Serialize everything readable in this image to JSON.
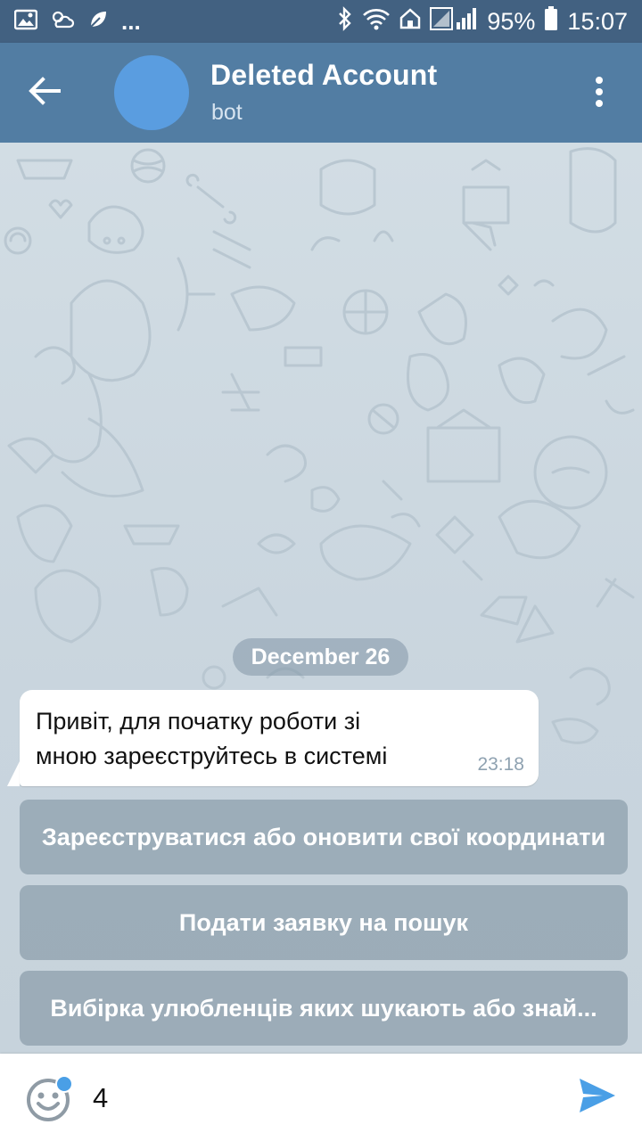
{
  "status_bar": {
    "battery": "95%",
    "time": "15:07",
    "more": "...",
    "icons": [
      "gallery-icon",
      "weather-icon",
      "leaf-icon",
      "bluetooth-icon",
      "wifi-icon",
      "home-icon",
      "signal-icon",
      "battery-icon"
    ]
  },
  "header": {
    "title": "Deleted Account",
    "subtitle": "bot",
    "avatar_color": "#5a9de0",
    "bar_color": "#527da3"
  },
  "chat": {
    "date_label": "December 26",
    "message": {
      "line1": "Привіт, для початку роботи зі",
      "line2": "мною зареєструйтесь в системі",
      "time": "23:18"
    },
    "keyboard_buttons": [
      "Зареєструватися або оновити свої координати",
      "Подати заявку на пошук",
      "Вибірка улюбленців яких шукають або знай..."
    ]
  },
  "input": {
    "value": "4",
    "accent_color": "#4a9fe6"
  }
}
